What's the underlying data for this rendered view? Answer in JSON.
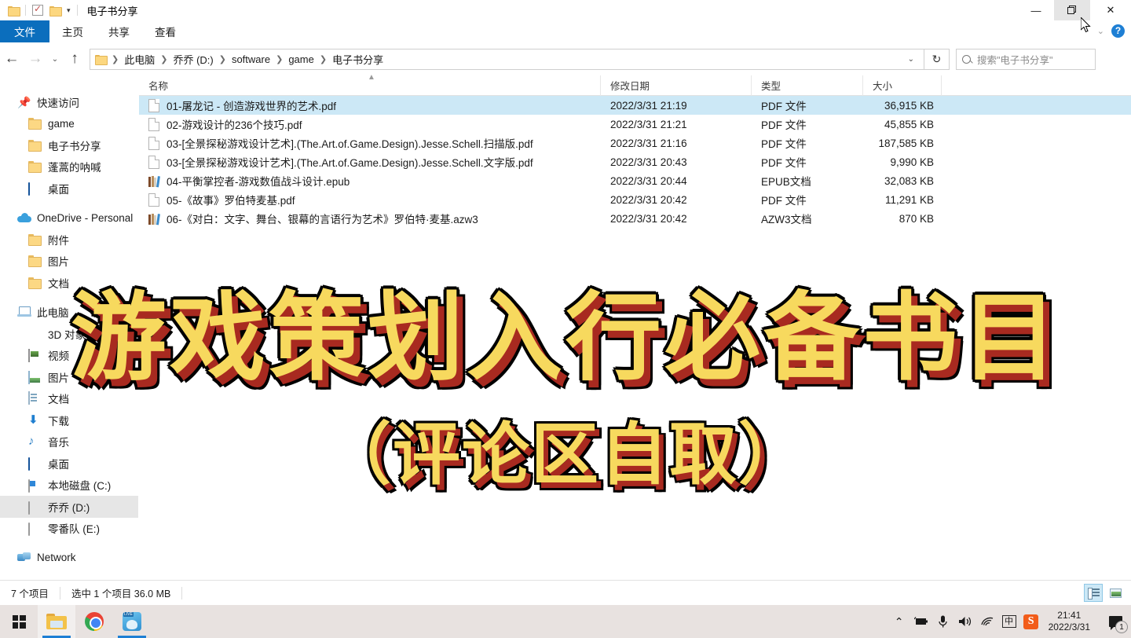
{
  "window": {
    "title": "电子书分享",
    "quick_access_toolbar": [
      {
        "icon": "folder-icon",
        "name": "properties-folder-icon"
      },
      {
        "icon": "checkbox-icon",
        "name": "new-folder-check-icon"
      },
      {
        "icon": "folder-icon",
        "name": "new-folder-icon"
      }
    ],
    "qat_dropdown": "▾",
    "controls": {
      "minimize": "—",
      "maximize": "❐",
      "close": "✕",
      "ribbon_collapse": "⌄",
      "help": "?"
    }
  },
  "ribbon": {
    "tabs": [
      {
        "label": "文件",
        "active": true
      },
      {
        "label": "主页",
        "active": false
      },
      {
        "label": "共享",
        "active": false
      },
      {
        "label": "查看",
        "active": false
      }
    ]
  },
  "addressbar": {
    "back": "←",
    "forward": "→",
    "recent": "⌄",
    "up": "↑",
    "breadcrumb": [
      "此电脑",
      "乔乔 (D:)",
      "software",
      "game",
      "电子书分享"
    ],
    "breadcrumb_caret": "⌄",
    "refresh": "↻",
    "search_placeholder": "搜索\"电子书分享\""
  },
  "navpane": {
    "sections": [
      {
        "title": "快速访问",
        "icon": "pin-icon",
        "items": [
          {
            "label": "game",
            "icon": "folder-icon"
          },
          {
            "label": "电子书分享",
            "icon": "folder-icon"
          },
          {
            "label": "蓬蒿的呐喊",
            "icon": "folder-icon"
          },
          {
            "label": "桌面",
            "icon": "desktop-icon"
          }
        ]
      },
      {
        "title": "OneDrive - Personal",
        "icon": "cloud-icon",
        "items": [
          {
            "label": "附件",
            "icon": "folder-icon"
          },
          {
            "label": "图片",
            "icon": "folder-icon"
          },
          {
            "label": "文档",
            "icon": "folder-icon"
          }
        ]
      },
      {
        "title": "此电脑",
        "icon": "pc-icon",
        "items": [
          {
            "label": "3D 对象",
            "icon": "3d-objects-icon"
          },
          {
            "label": "视频",
            "icon": "video-icon"
          },
          {
            "label": "图片",
            "icon": "pictures-icon"
          },
          {
            "label": "文档",
            "icon": "documents-icon"
          },
          {
            "label": "下载",
            "icon": "downloads-icon"
          },
          {
            "label": "音乐",
            "icon": "music-icon"
          },
          {
            "label": "桌面",
            "icon": "desktop-icon"
          },
          {
            "label": "本地磁盘 (C:)",
            "icon": "system-drive-icon"
          },
          {
            "label": "乔乔 (D:)",
            "icon": "drive-icon",
            "selected": true
          },
          {
            "label": "零番队 (E:)",
            "icon": "drive-icon"
          }
        ]
      },
      {
        "title": "Network",
        "icon": "network-icon",
        "items": []
      }
    ]
  },
  "filelist": {
    "columns": [
      "名称",
      "修改日期",
      "类型",
      "大小"
    ],
    "sort_indicator": "▲",
    "rows": [
      {
        "name": "01-屠龙记 - 创造游戏世界的艺术.pdf",
        "date": "2022/3/31 21:19",
        "type": "PDF 文件",
        "size": "36,915 KB",
        "icon": "pdf-file-icon",
        "selected": true
      },
      {
        "name": "02-游戏设计的236个技巧.pdf",
        "date": "2022/3/31 21:21",
        "type": "PDF 文件",
        "size": "45,855 KB",
        "icon": "pdf-file-icon",
        "selected": false
      },
      {
        "name": "03-[全景探秘游戏设计艺术].(The.Art.of.Game.Design).Jesse.Schell.扫描版.pdf",
        "date": "2022/3/31 21:16",
        "type": "PDF 文件",
        "size": "187,585 KB",
        "icon": "pdf-file-icon",
        "selected": false
      },
      {
        "name": "03-[全景探秘游戏设计艺术].(The.Art.of.Game.Design).Jesse.Schell.文字版.pdf",
        "date": "2022/3/31 20:43",
        "type": "PDF 文件",
        "size": "9,990 KB",
        "icon": "pdf-file-icon",
        "selected": false
      },
      {
        "name": "04-平衡掌控者-游戏数值战斗设计.epub",
        "date": "2022/3/31 20:44",
        "type": "EPUB文档",
        "size": "32,083 KB",
        "icon": "ebook-file-icon",
        "selected": false
      },
      {
        "name": "05-《故事》罗伯特麦基.pdf",
        "date": "2022/3/31 20:42",
        "type": "PDF 文件",
        "size": "11,291 KB",
        "icon": "pdf-file-icon",
        "selected": false
      },
      {
        "name": "06-《对白：文字、舞台、银幕的言语行为艺术》罗伯特·麦基.azw3",
        "date": "2022/3/31 20:42",
        "type": "AZW3文档",
        "size": "870 KB",
        "icon": "ebook-file-icon",
        "selected": false
      }
    ]
  },
  "statusbar": {
    "item_count": "7 个项目",
    "selection": "选中 1 个项目  36.0 MB",
    "view_details": "details-view",
    "view_tiles": "large-icons-view"
  },
  "overlay": {
    "line1": "游戏策划入行必备书目",
    "line2": "（评论区自取）",
    "fill_color": "#f7d95e",
    "shadow_color": "#a82a20",
    "outline_color": "#000000"
  },
  "taskbar": {
    "start": "start-button",
    "apps": [
      {
        "name": "file-explorer",
        "active": true
      },
      {
        "name": "google-chrome",
        "active": false
      },
      {
        "name": "live-app",
        "active": true
      }
    ],
    "tray": {
      "overflow": "⌃",
      "battery": "battery-icon",
      "microphone": "microphone-icon",
      "volume": "volume-icon",
      "network": "wifi-icon",
      "ime": "中",
      "sogou": "S",
      "time": "21:41",
      "date": "2022/3/31",
      "notification_count": "1"
    }
  }
}
